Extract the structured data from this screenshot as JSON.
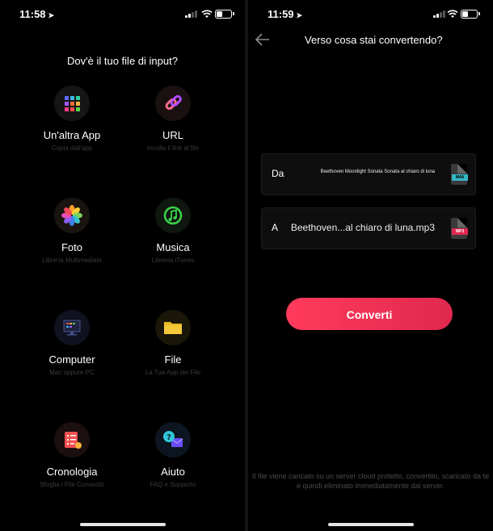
{
  "left": {
    "status": {
      "time": "11:58"
    },
    "heading": "Dov'è il tuo file di input?",
    "options": [
      {
        "label": "Un'altra App",
        "sub": "Copia dall'app",
        "icon": "apps-grid-icon"
      },
      {
        "label": "URL",
        "sub": "Incolla il link al file",
        "icon": "link-icon"
      },
      {
        "label": "Foto",
        "sub": "Libreria Multimediale",
        "icon": "photos-icon"
      },
      {
        "label": "Musica",
        "sub": "Libreria iTunes",
        "icon": "music-icon"
      },
      {
        "label": "Computer",
        "sub": "Mac oppure PC",
        "icon": "computer-icon"
      },
      {
        "label": "File",
        "sub": "La Tua App dei File",
        "icon": "folder-icon"
      },
      {
        "label": "Cronologia",
        "sub": "Sfoglia i File Convertiti",
        "icon": "history-icon"
      },
      {
        "label": "Aiuto",
        "sub": "FAQ e Supporto",
        "icon": "help-icon"
      }
    ]
  },
  "right": {
    "status": {
      "time": "11:59"
    },
    "title": "Verso cosa stai convertendo?",
    "from": {
      "key": "Da",
      "name": "Beethoven Moonlight Sonata Sonata al chiaro di luna",
      "type": "M4A",
      "type_color": "#35b6c4"
    },
    "to": {
      "key": "A",
      "name": "Beethoven...al chiaro di luna.mp3",
      "type": "MP3",
      "type_color": "#e0284e"
    },
    "convert_label": "Converti",
    "footer": "Il file viene caricato su un server cloud protetto, convertito, scaricato da te e quindi eliminato immediatamente dal server."
  },
  "colors": {
    "accent": "#ff3b5c",
    "background": "#000000"
  }
}
